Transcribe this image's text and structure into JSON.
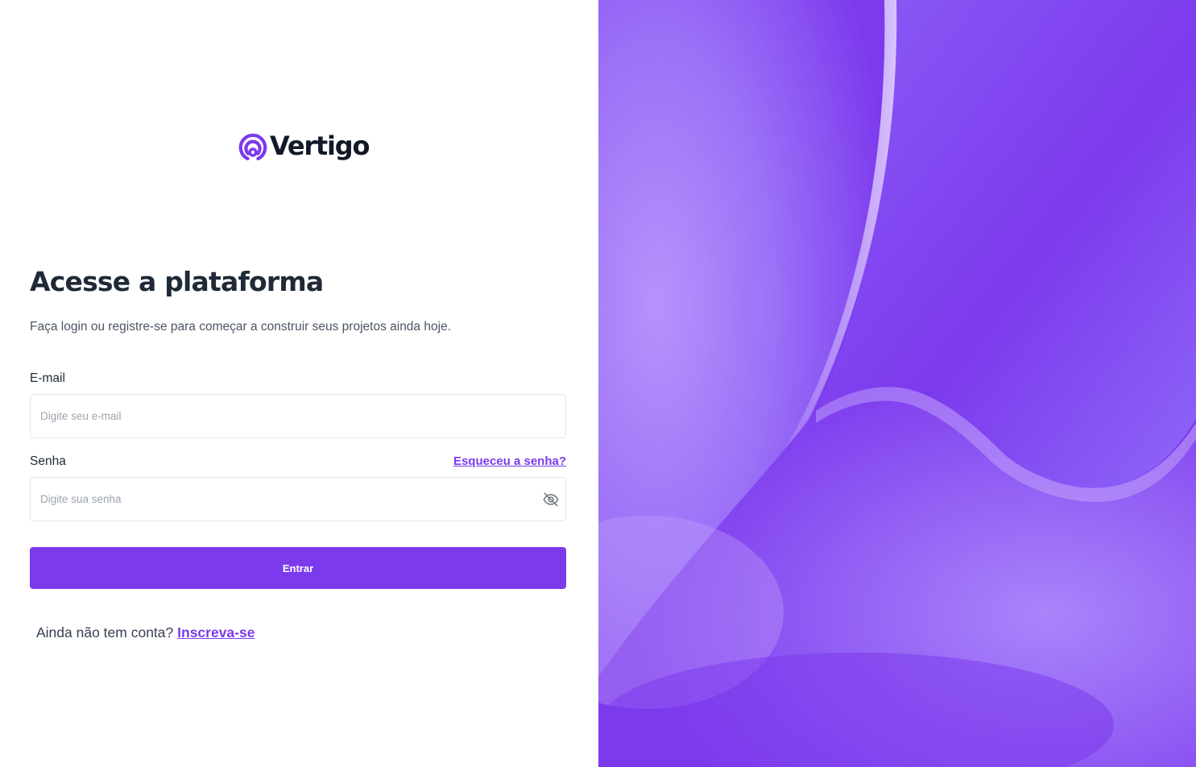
{
  "brand": {
    "name": "Vertigo",
    "logo_icon": "vertigo-signal-icon",
    "accent_color": "#7c3aed",
    "text_color": "#111827"
  },
  "login": {
    "title": "Acesse a plataforma",
    "subtitle": "Faça login ou registre-se para começar a construir seus projetos ainda hoje.",
    "email": {
      "label": "E-mail",
      "placeholder": "Digite seu e-mail",
      "value": ""
    },
    "password": {
      "label": "Senha",
      "placeholder": "Digite sua senha",
      "value": "",
      "forgot_link": "Esqueceu a senha?",
      "toggle_icon": "eye-off-icon"
    },
    "submit_label": "Entrar",
    "signup_prompt": "Ainda não tem conta?",
    "signup_link": "Inscreva-se"
  },
  "hero": {
    "background_color": "#7c3aed",
    "highlight_color": "#c4a4fb"
  }
}
